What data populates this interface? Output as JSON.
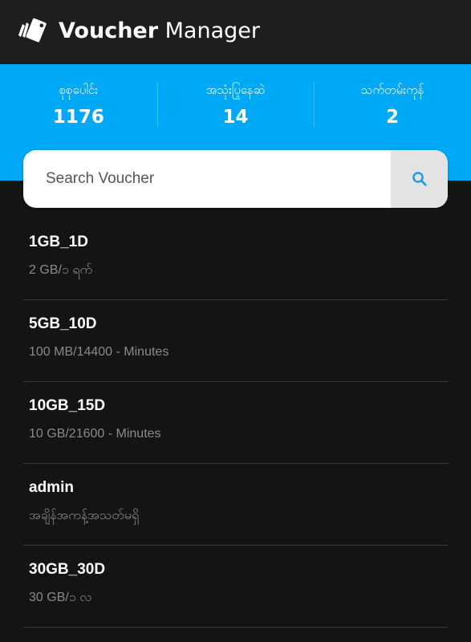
{
  "app": {
    "title_bold": "Voucher",
    "title_light": "Manager",
    "logo_icon": "vouchers-logo-icon"
  },
  "stats": [
    {
      "label": "စုစုပေါင်း",
      "value": "1176"
    },
    {
      "label": "အသုံးပြုနေဆဲ",
      "value": "14"
    },
    {
      "label": "သက်တမ်းကုန်",
      "value": "2"
    }
  ],
  "search": {
    "placeholder": "Search Voucher",
    "value": "",
    "icon": "search-icon"
  },
  "vouchers": [
    {
      "name": "1GB_1D",
      "detail": "2 GB/၁ ရက်"
    },
    {
      "name": "5GB_10D",
      "detail": "100 MB/14400 - Minutes"
    },
    {
      "name": "10GB_15D",
      "detail": "10 GB/21600 - Minutes"
    },
    {
      "name": "admin",
      "detail": "အချိန်အကန့်အသတ်မရှိ"
    },
    {
      "name": "30GB_30D",
      "detail": "30 GB/၁ လ"
    }
  ],
  "colors": {
    "accent": "#00a9f6",
    "background": "#141414",
    "app_bar": "#1e1e1e"
  }
}
